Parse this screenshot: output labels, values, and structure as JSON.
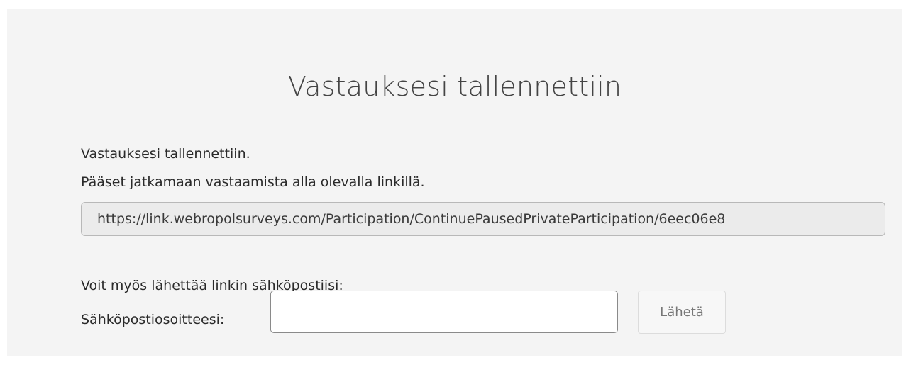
{
  "page": {
    "title": "Vastauksesi tallennettiin"
  },
  "message": {
    "line1": "Vastauksesi tallennettiin.",
    "line2": "Pääset jatkamaan vastaamista alla olevalla linkillä."
  },
  "continue_link": {
    "value": "https://link.webropolsurveys.com/Participation/ContinuePausedPrivateParticipation/6eec06e8"
  },
  "email": {
    "hint": "Voit myös lähettää linkin sähköpostiisi:",
    "label": "Sähköpostiosoitteesi:",
    "value": "",
    "send_label": "Lähetä"
  },
  "colors": {
    "panel_background": "#f4f4f4",
    "link_field_background": "#ebebeb",
    "button_text": "#777777"
  }
}
